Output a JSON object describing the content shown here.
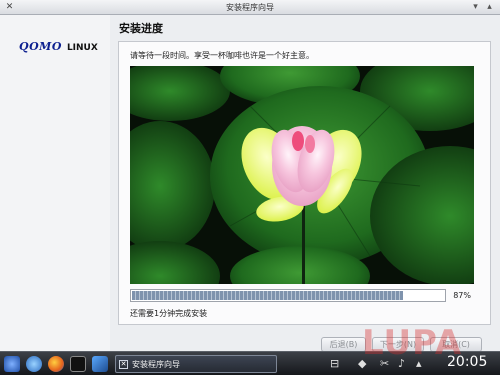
{
  "window": {
    "title": "安装程序向导",
    "close_icon": "x-icon",
    "minimize_icon": "minimize-icon",
    "maximize_icon": "maximize-icon"
  },
  "sidebar": {
    "brand": "QOMO",
    "brand_suffix": "LINUX"
  },
  "main": {
    "heading": "安装进度",
    "instruction": "请等待一段时间。享受一杯咖啡也许是一个好主意。",
    "progress": {
      "value": 0.87,
      "label": "87%"
    },
    "remaining": "还需要1分钟完成安装",
    "buttons": {
      "back": "后退(B)",
      "next": "下一步(N)",
      "cancel": "取消(C)"
    }
  },
  "taskbar": {
    "task_label": "安装程序向导",
    "clock": "20:05",
    "colors": {
      "accent": "#7f93ad",
      "bar": "#1c1f24"
    }
  },
  "watermark": "LUPA"
}
